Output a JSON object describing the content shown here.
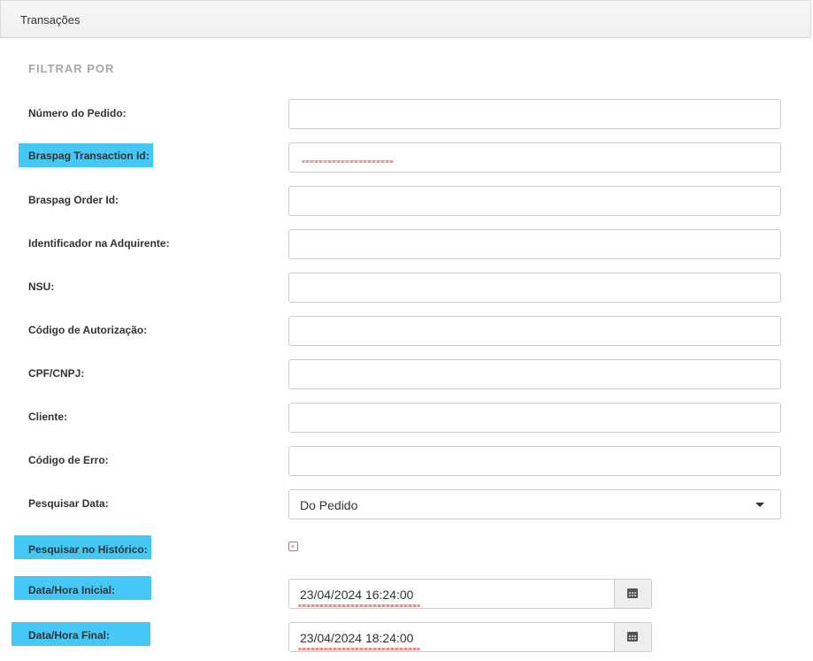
{
  "panel": {
    "title": "Transações"
  },
  "filter": {
    "section_title": "FILTRAR POR",
    "fields": {
      "numero_pedido": {
        "label": "Número do Pedido:",
        "value": ""
      },
      "transaction_id": {
        "label": "Braspag Transaction Id:",
        "value": ""
      },
      "order_id": {
        "label": "Braspag Order Id:",
        "value": ""
      },
      "adquirente": {
        "label": "Identificador na Adquirente:",
        "value": ""
      },
      "nsu": {
        "label": "NSU:",
        "value": ""
      },
      "autorizacao": {
        "label": "Código de Autorização:",
        "value": ""
      },
      "cpf": {
        "label": "CPF/CNPJ:",
        "value": ""
      },
      "cliente": {
        "label": "Cliente:",
        "value": ""
      },
      "erro": {
        "label": "Código de Erro:",
        "value": ""
      },
      "pesquisar_data": {
        "label": "Pesquisar Data:",
        "selected": "Do Pedido"
      },
      "historico": {
        "label": "Pesquisar no Histórico:",
        "checked": false
      },
      "data_inicial": {
        "label": "Data/Hora Inicial:",
        "value": "23/04/2024 16:24:00"
      },
      "data_final": {
        "label": "Data/Hora Final:",
        "value": "23/04/2024 18:24:00"
      }
    }
  },
  "icons": {
    "dropdown": "chevron-down-icon",
    "calendar": "calendar-icon"
  },
  "colors": {
    "highlight": "#45c8f5",
    "header_bg": "#f2f2f2",
    "section_title": "#a6a6a6"
  }
}
